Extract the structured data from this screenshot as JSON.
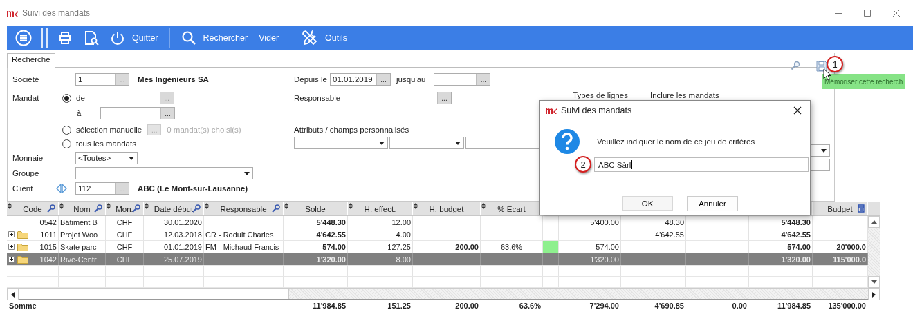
{
  "window": {
    "title": "Suivi des mandats"
  },
  "toolbar": [
    {
      "kind": "menu"
    },
    {
      "kind": "divider"
    },
    {
      "kind": "print"
    },
    {
      "kind": "preview"
    },
    {
      "kind": "power",
      "label": "Quitter"
    },
    {
      "kind": "separator"
    },
    {
      "kind": "search",
      "label": "Rechercher"
    },
    {
      "kind": "text",
      "label": "Vider"
    },
    {
      "kind": "separator"
    },
    {
      "kind": "tools",
      "label": "Outils"
    }
  ],
  "search_panel": {
    "tabs": [
      {
        "label": "Recherche",
        "selected": true
      }
    ],
    "tooltip": "Mémoriser cette recherch",
    "company": {
      "label": "Société",
      "value": "1",
      "button": "...",
      "name": "Mes Ingénieurs SA"
    },
    "mandate": {
      "label": "Mandat",
      "options": [
        {
          "label": "de",
          "selected": true
        },
        {
          "label": "sélection manuelle",
          "selected": false
        },
        {
          "label": "tous les mandats",
          "selected": false
        }
      ],
      "from": {
        "button": "..."
      },
      "to_label": "à",
      "to": {
        "button": "..."
      },
      "manual_button": {
        "label": "...",
        "disabled": true
      },
      "manual_count": "0 mandat(s) choisi(s)"
    },
    "currency": {
      "label": "Monnaie",
      "value": "<Toutes>"
    },
    "group": {
      "label": "Groupe"
    },
    "client": {
      "label": "Client",
      "value": "112",
      "button": "...",
      "name": "ABC (Le Mont-sur-Lausanne)"
    },
    "since": {
      "label": "Depuis le",
      "value": "01.01.2019",
      "button": "..."
    },
    "until": {
      "label": "jusqu'au",
      "button": "..."
    },
    "manager": {
      "label": "Responsable",
      "button": "..."
    },
    "attributes": {
      "label": "Attributs / champs personnalisés"
    },
    "line_types": {
      "label": "Types de lignes"
    },
    "include": {
      "label": "Inclure les mandats"
    }
  },
  "table": {
    "columns": [
      {
        "label": "Code",
        "filter": true
      },
      {
        "label": "Nom",
        "filter": true
      },
      {
        "label": "Mon.",
        "filter": true
      },
      {
        "label": "Date début",
        "filter": true
      },
      {
        "label": "Responsable",
        "filter": true
      },
      {
        "label": "Solde",
        "filter": false
      },
      {
        "label": "H. effect.",
        "filter": false
      },
      {
        "label": "H. budget",
        "filter": false
      },
      {
        "label": "% Ecart",
        "filter": false
      },
      {},
      {},
      {},
      {},
      {},
      {
        "label": "Budget",
        "filter": false
      }
    ],
    "rows": [
      {
        "selected": false,
        "expandable": false,
        "code": "0542",
        "name": "Bâtiment B",
        "currency": "CHF",
        "start_date": "30.01.2020",
        "balance": "5'448.30",
        "hours_actual": "12.00",
        "column_11": "5'400.00",
        "column_12": "48.30",
        "column_14": "5'448.30"
      },
      {
        "selected": false,
        "expandable": true,
        "code": "1011",
        "name": "Projet Woo",
        "currency": "CHF",
        "start_date": "12.03.2018",
        "manager": "CR - Roduit Charles",
        "balance": "4'642.55",
        "hours_actual": "4.00",
        "column_12": "4'642.55",
        "column_14": "4'642.55"
      },
      {
        "selected": false,
        "expandable": true,
        "code": "1015",
        "name": "Skate parc",
        "currency": "CHF",
        "start_date": "01.01.2019",
        "manager": "FM - Michaud Francis",
        "balance": "574.00",
        "hours_actual": "127.25",
        "hours_budget": "200.00",
        "variance_pct": "63.6%",
        "color": "#8ef08e",
        "column_11": "574.00",
        "column_14": "574.00",
        "budget": "20'000.0"
      },
      {
        "selected": true,
        "expandable": true,
        "code": "1042",
        "name": "Rive-Centr",
        "currency": "CHF",
        "start_date": "25.07.2019",
        "balance": "1'320.00",
        "hours_actual": "8.00",
        "column_11": "1'320.00",
        "column_14": "1'320.00",
        "budget": "115'000.0"
      }
    ],
    "totals": {
      "label": "Somme",
      "balance": "11'984.85",
      "hours_actual": "151.25",
      "hours_budget": "200.00",
      "variance_pct": "63.6%",
      "column_11": "7'294.00",
      "column_12": "4'690.85",
      "column_13": "0.00",
      "column_14": "11'984.85",
      "budget": "135'000.00"
    }
  },
  "dialog": {
    "title": "Suivi des mandats",
    "message": "Veuillez indiquer le nom de ce jeu de critères",
    "value": "ABC Sàrl",
    "buttons": [
      {
        "label": "OK",
        "default": true
      },
      {
        "label": "Annuler",
        "default": false
      }
    ]
  },
  "callouts": [
    "1",
    "2"
  ]
}
